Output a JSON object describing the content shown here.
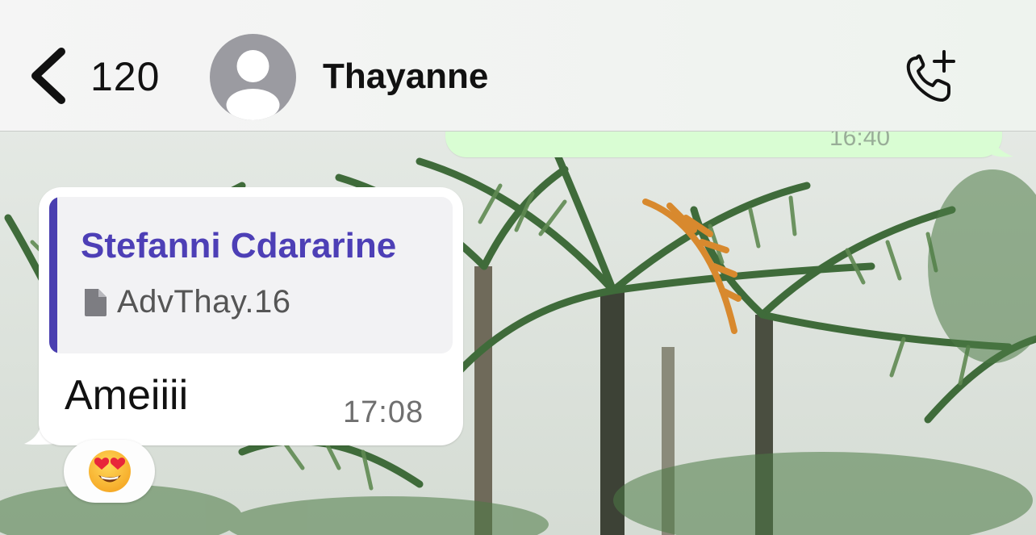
{
  "header": {
    "back_count": "120",
    "contact_name": "Thayanne"
  },
  "outgoing_message": {
    "time": "16:40"
  },
  "incoming_message": {
    "quote": {
      "author": "Stefanni Cdararine",
      "file_name": "AdvThay.16"
    },
    "text": "Ameiiii",
    "time": "17:08",
    "reaction": "heart-eyes-emoji"
  },
  "colors": {
    "quote_author": "#4d3fb6",
    "quote_bar": "#4a3fb0",
    "outgoing_bubble": "#d9fdd3",
    "incoming_bubble": "#ffffff"
  }
}
